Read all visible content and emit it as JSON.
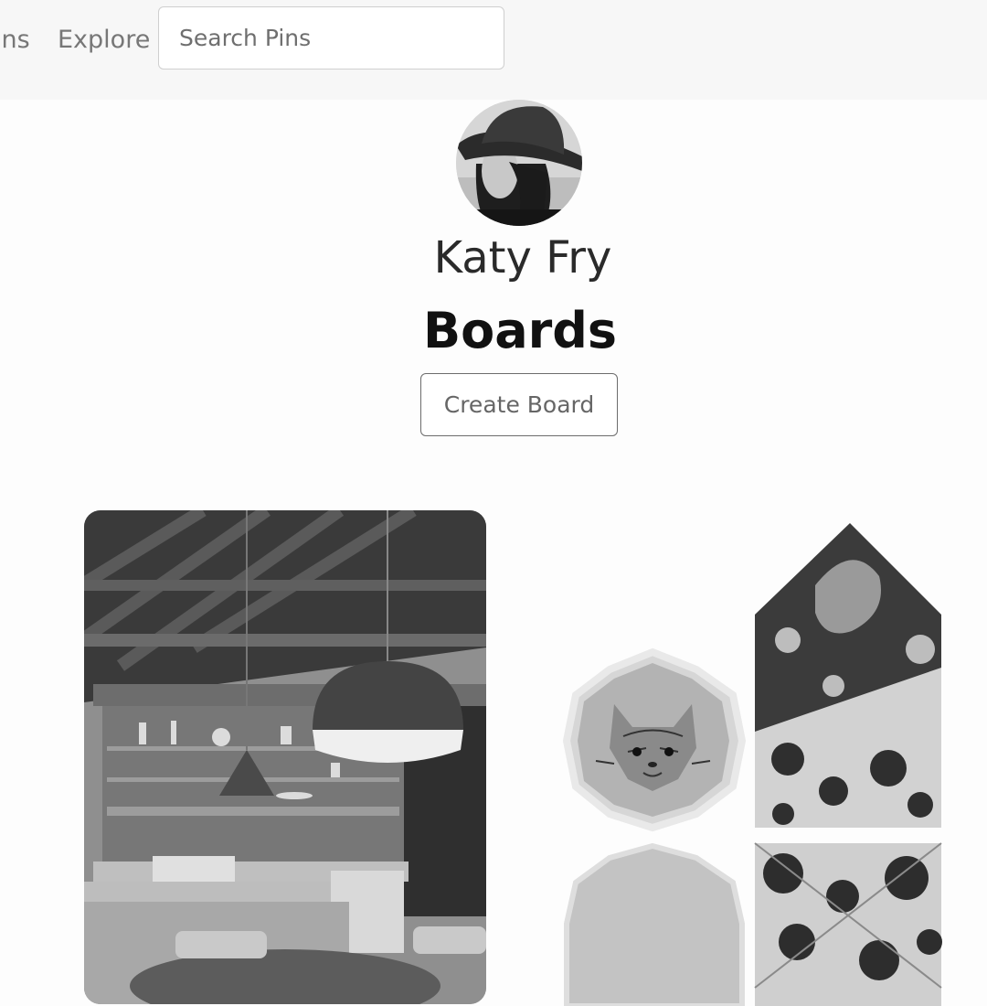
{
  "nav": {
    "pins_label": "ins",
    "explore_label": "Explore",
    "search_placeholder": "Search Pins"
  },
  "profile": {
    "name": "Katy Fry"
  },
  "boards": {
    "title": "Boards",
    "create_label": "Create Board",
    "items": [
      {
        "image": "kitchen-photo"
      },
      {
        "image": "cat-plate-and-floral-envelopes-photo"
      }
    ]
  }
}
